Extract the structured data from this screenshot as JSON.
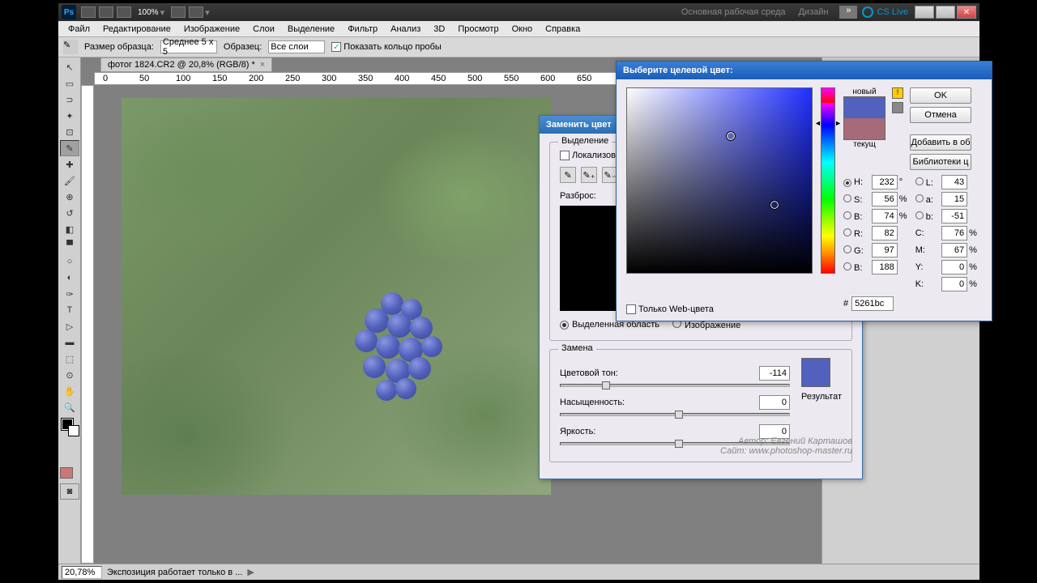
{
  "titlebar": {
    "zoom_label": "100%",
    "workspace1": "Основная рабочая среда",
    "workspace2": "Дизайн",
    "cslive": "CS Live"
  },
  "menu": [
    "Файл",
    "Редактирование",
    "Изображение",
    "Слои",
    "Выделение",
    "Фильтр",
    "Анализ",
    "3D",
    "Просмотр",
    "Окно",
    "Справка"
  ],
  "options": {
    "sample_size_label": "Размер образца:",
    "sample_size_value": "Среднее 5 x 5",
    "sample_label": "Образец:",
    "sample_value": "Все слои",
    "show_ring": "Показать кольцо пробы"
  },
  "document": {
    "tab": "фотог 1824.CR2 @ 20,8% (RGB/8) *"
  },
  "status": {
    "zoom": "20,78%",
    "msg": "Экспозиция работает только в ..."
  },
  "replace": {
    "title": "Заменить цвет",
    "selection_legend": "Выделение",
    "localized": "Локализован",
    "fuzziness": "Разброс:",
    "radio_selection": "Выделенная область",
    "radio_image": "Изображение",
    "replace_legend": "Замена",
    "hue_label": "Цветовой тон:",
    "hue_value": "-114",
    "sat_label": "Насыщенность:",
    "sat_value": "0",
    "light_label": "Яркость:",
    "light_value": "0",
    "result_label": "Результат"
  },
  "picker": {
    "title": "Выберите целевой цвет:",
    "new_label": "новый",
    "current_label": "текущ",
    "btn_ok": "OK",
    "btn_cancel": "Отмена",
    "btn_add": "Добавить в об",
    "btn_libraries": "Библиотеки ц",
    "web_only": "Только Web-цвета",
    "H": "232",
    "S": "56",
    "B": "74",
    "R": "82",
    "G": "97",
    "Bv": "188",
    "L": "43",
    "a": "15",
    "b": "-51",
    "C": "76",
    "M": "67",
    "Y": "0",
    "K": "0",
    "hex": "5261bc",
    "new_color": "#5261bc",
    "cur_color": "#a66b78"
  },
  "author_line1": "Автор: Евгений Карташов",
  "author_line2": "Сайт: www.photoshop-master.ru"
}
